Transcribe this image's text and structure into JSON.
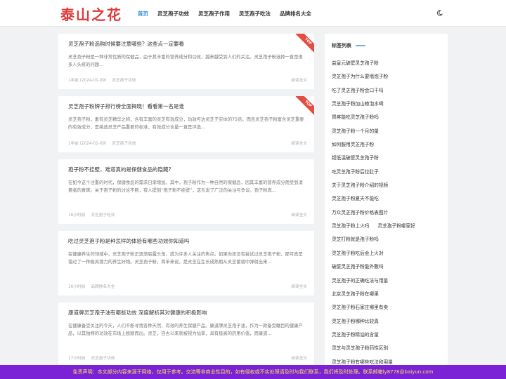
{
  "header": {
    "logo": "泰山之花",
    "nav": [
      "首页",
      "灵芝孢子功效",
      "灵芝孢子作用",
      "灵芝孢子吃法",
      "品牌排名大全"
    ]
  },
  "articles": [
    {
      "title": "灵芝孢子粉选购时候要注意哪些？这些点一定要看",
      "excerpt": "灵芝孢子粉是一种非常优质的保健品，由于其丰富的营养成分和功效，越来越受到人们的关注。灵芝孢子粉选择一直是很多人头疼的问题...",
      "time": "1年前 (2024-01-09)",
      "category": "灵芝孢子功效",
      "more": "阅读全文",
      "badge": "TOP"
    },
    {
      "title": "灵芝孢子粉牌子排行榜全面揭晓！看看第一名是谁",
      "excerpt": "灵芝孢子粉，素有灵芝精华之称，含有丰富的灵芝有效成分，功效可达灵芝子实体的75倍。而且灵芝孢子粉富含灵芝重要的有效成分，是挑选灵芝产品重要的标准，有效成分含量一直是评选...",
      "time": "1年前 (2024-01-09)",
      "category": "灵芝孢子功效",
      "more": "阅读全文",
      "badge": "TOP"
    },
    {
      "title": "孢子粉不挂壁，难道真的是保健食品的隐藏?",
      "excerpt": "在如今这个注重的时代，保健食品的需求日渐增加。其中，孢子粉作为一种自然的保健品，因其丰富的营养成分而受到消费者的青睐。关于孢子粉的讨论不断，有人提到“孢子粉不挂壁”，这引发了广泛的关注与争议。孢子粉真...",
      "time": "16小时前",
      "category": "灵芝孢子吃法",
      "more": "阅读全文",
      "badge": ""
    },
    {
      "title": "吃过灵芝孢子粉是种怎样的体验有哪些功效你知道吗",
      "excerpt": "在健康养生的领域中，灵芝孢子粉正逐渐崭露头角，成为许多人关注的焦点。如果你还没有尝试过灵芝孢子粉，那可真是错过了一种极具潜力的养生好物。灵芝孢子粉，简单来说，是灵芝在生长成熟期从灵芝菌褶中弹射出来...",
      "time": "16小时前",
      "category": "品牌排名大全",
      "more": "阅读全文",
      "badge": ""
    },
    {
      "title": "康道牌灵芝孢子油有哪些功效 深度解析其对健康的积极影响",
      "excerpt": "在健康备受关注的今天，人们不断寻找各种天然、有效的养生保健产品。康道牌灵芝孢子油，作为一款备受瞩目的健康产品，以其独特的功效在市场上脱颖而出。灵芝，自古以来就被视为仙草，具有极高的药用价值，而康道...",
      "time": "17小时前",
      "category": "灵芝孢子功效",
      "more": "阅读全文",
      "badge": ""
    }
  ],
  "sidebar": {
    "heading": "标签列表",
    "tags": [
      "益皇元破壁灵芝孢子粉",
      "灵芝孢子为什么要墙泡子粉",
      "吃了灵芝孢子粉会口干吗",
      "灵芝孢子粉加山楂泡水喝",
      "胃疼能吃灵芝孢子粉吗",
      "灵芝孢子粉一个月的量",
      "如何服用灵芝孢子粉",
      "超低温破壁灵芝孢子粉",
      "吃灵芝孢子粉后拉肚子",
      "关于灵芝孢子粉介绍的视频",
      "灵芝孢子粉夏天不能吃",
      "万众灵芝孢子粉价格表图片",
      "灵芝孢子粉上火吗",
      "灵芝孢子粉哪家好",
      "灵芝打粉就是孢子粉吗",
      "灵芝孢子粉吃后会上火对",
      "破壁灵芝孢子粉能外敷吗",
      "灵芝孢子的正确吃法与用量",
      "北京灵芝孢子粉在哪里",
      "灵芝孢子粉石家庄哪里有卖",
      "灵芝孢子粉哪种比较真",
      "灵芝孢子粉精油的含量",
      "灵芝与灵芝孢子粉药性区别",
      "灵芝孢子粉有哪些吃法和用量"
    ]
  },
  "footer": {
    "notice": "免责声明：本文部分内容来源于网络，仅用于参考。交流等非商业性目的，如有侵权或不实处理请及时与我们联系，我们将及时处理。联系邮箱ly8778@baiyun.com"
  }
}
